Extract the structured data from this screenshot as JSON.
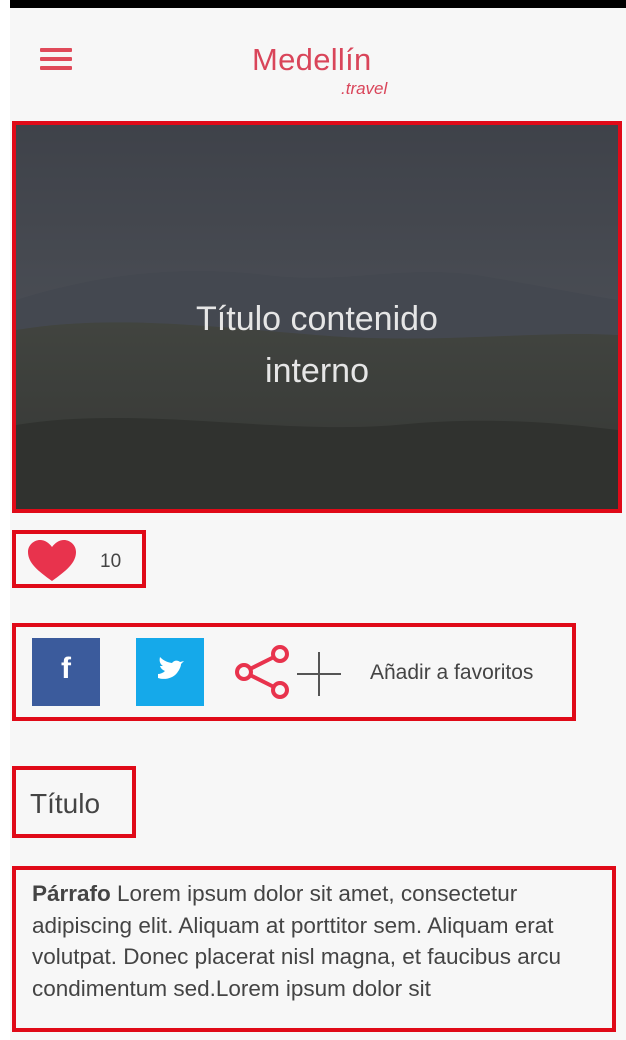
{
  "header": {
    "brand": "Medellín",
    "brand_suffix": ".travel"
  },
  "hero": {
    "title": "Título contenido\ninterno"
  },
  "likes": {
    "count": "10"
  },
  "share": {
    "facebook_glyph": "f",
    "favorites_label": "Añadir a favoritos"
  },
  "content": {
    "title": "Título",
    "paragraph_lead": "Párrafo",
    "paragraph_body": " Lorem ipsum dolor sit amet, consectetur adipiscing elit. Aliquam at porttitor sem. Aliquam erat volutpat. Donec placerat nisl magna, et faucibus arcu condimentum sed.Lorem ipsum dolor sit"
  },
  "icons": {
    "menu": "menu-icon",
    "heart": "heart-icon",
    "facebook": "facebook-icon",
    "twitter": "twitter-icon",
    "share": "share-icon",
    "plus": "plus-icon"
  },
  "colors": {
    "brand": "#d9455a",
    "heart": "#e8334d",
    "facebook": "#3b5b9c",
    "twitter": "#15a9ea",
    "annotation": "#e00a18",
    "text": "#444444",
    "background": "#f7f7f7"
  }
}
